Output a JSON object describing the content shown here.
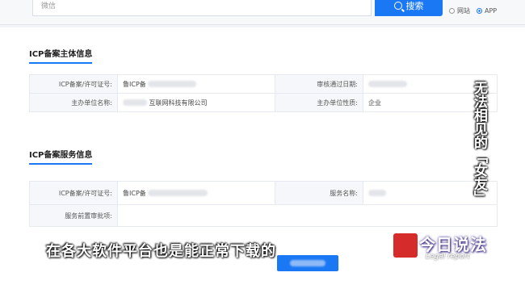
{
  "search": {
    "placeholder": "微信",
    "button_label": "搜索",
    "options": [
      "网站",
      "APP"
    ],
    "selected": "APP"
  },
  "section1": {
    "title": "ICP备案主体信息",
    "rows": [
      {
        "label1": "ICP备案/许可证号:",
        "value1": "鲁ICP备",
        "label2": "审核通过日期:",
        "value2": ""
      },
      {
        "label1": "主办单位名称:",
        "value1": "互联网科技有限公司",
        "label2": "主办单位性质:",
        "value2": "企业"
      }
    ]
  },
  "section2": {
    "title": "ICP备案服务信息",
    "rows": [
      {
        "label1": "ICP备案/许可证号:",
        "value1": "鲁ICP备",
        "label2": "服务名称:",
        "value2": ""
      },
      {
        "label1": "服务前置审批项:",
        "value1": ""
      }
    ]
  },
  "overlay": {
    "subtitle": "在各大软件平台也是能正常下载的",
    "vertical_caption": "无法相见的「女友」",
    "logo_title": "今日说法",
    "logo_subtitle": "Legal report"
  },
  "colors": {
    "accent": "#1a78f5",
    "logo_red": "#d52b2b"
  }
}
